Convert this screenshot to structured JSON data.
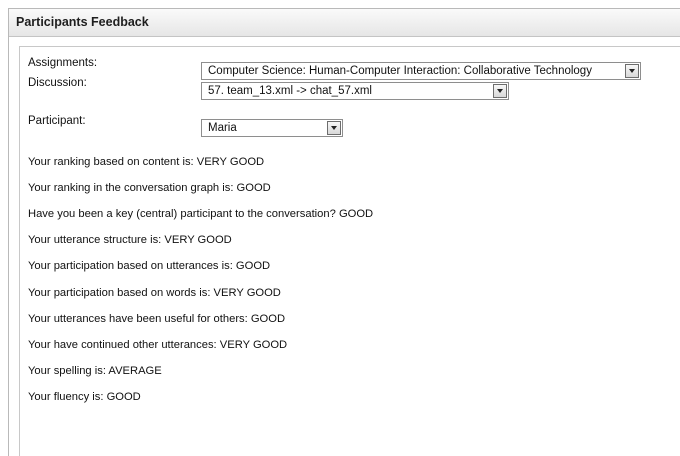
{
  "window": {
    "title": "Participants Feedback"
  },
  "form": {
    "assignments_label": "Assignments:",
    "assignments_value": "Computer Science: Human-Computer Interaction: Collaborative Technology",
    "discussion_label": "Discussion:",
    "discussion_value": "57. team_13.xml -> chat_57.xml",
    "participant_label": "Participant:",
    "participant_value": "Maria"
  },
  "feedback": [
    "Your ranking based on content is: VERY GOOD",
    "Your ranking in the conversation graph is: GOOD",
    "Have you been a key (central) participant to the conversation? GOOD",
    "Your utterance structure is: VERY GOOD",
    "Your participation based on utterances is: GOOD",
    "Your participation based on words is: VERY GOOD",
    "Your utterances have been useful for others: GOOD",
    "Your have continued other utterances: VERY GOOD",
    "Your spelling is: AVERAGE",
    "Your fluency is: GOOD"
  ],
  "icons": {
    "dropdown": "chevron-down-icon"
  }
}
